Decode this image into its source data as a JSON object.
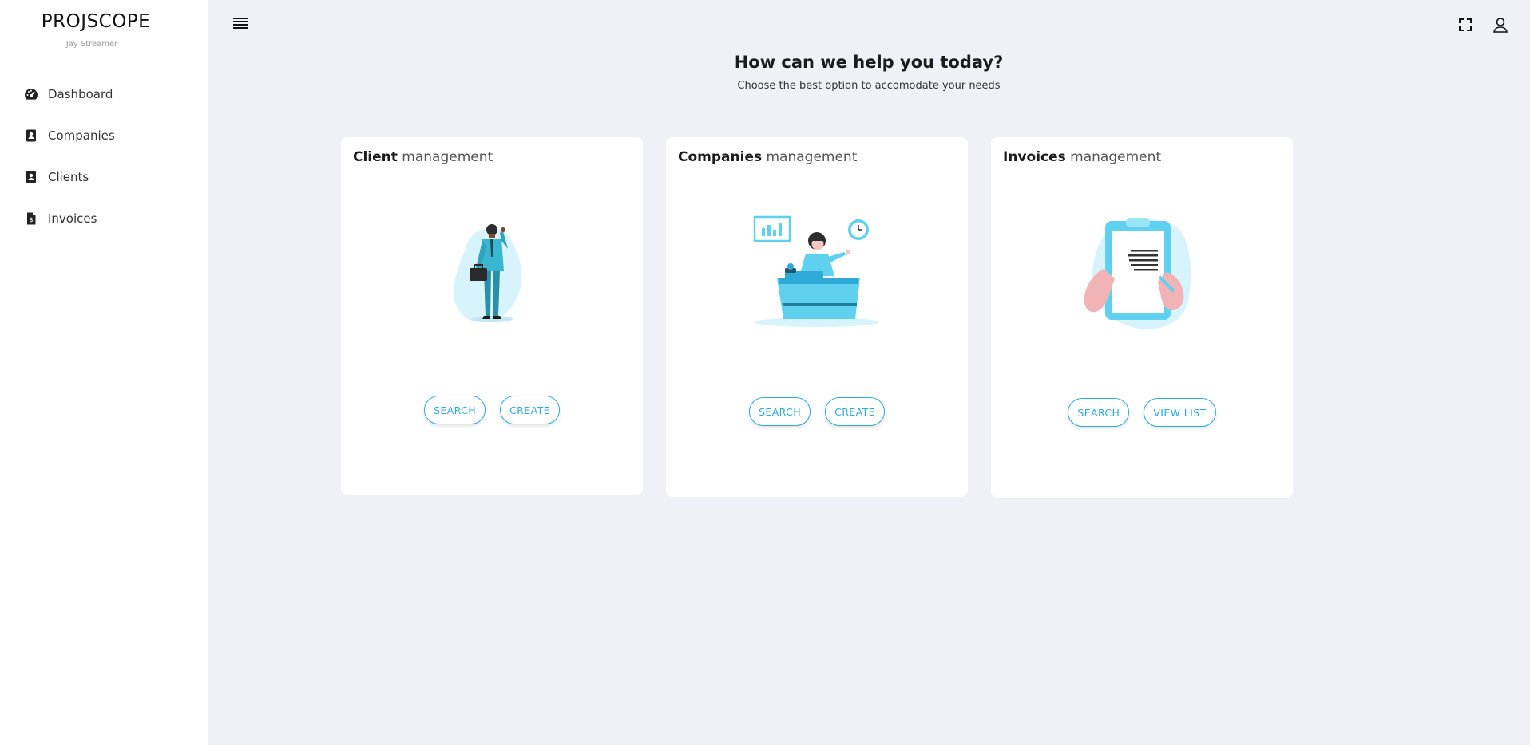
{
  "app": {
    "brand": "PROJSCOPE",
    "user_name": "Jay Streamer"
  },
  "sidebar": {
    "items": [
      {
        "label": "Dashboard",
        "icon": "dashboard-gauge-icon"
      },
      {
        "label": "Companies",
        "icon": "contact-book-icon"
      },
      {
        "label": "Clients",
        "icon": "contact-book-icon"
      },
      {
        "label": "Invoices",
        "icon": "invoice-file-icon"
      }
    ]
  },
  "topbar": {
    "menu_icon": "hamburger-menu-icon",
    "fullscreen_icon": "fullscreen-icon",
    "user_icon": "user-icon"
  },
  "hero": {
    "title": "How can we help you today?",
    "subtitle": "Choose the best option to accomodate your needs"
  },
  "cards": [
    {
      "title_bold": "Client",
      "title_rest": " management",
      "illustration": "businessman-on-phone-illustration",
      "buttons": [
        "SEARCH",
        "CREATE"
      ]
    },
    {
      "title_bold": "Companies",
      "title_rest": " management",
      "illustration": "receptionist-desk-illustration",
      "buttons": [
        "SEARCH",
        "CREATE"
      ]
    },
    {
      "title_bold": "Invoices",
      "title_rest": " management",
      "illustration": "clipboard-signing-illustration",
      "buttons": [
        "SEARCH",
        "VIEW LIST"
      ]
    }
  ],
  "colors": {
    "accent": "#2fa9d7",
    "illustration_blue": "#5fd0ee",
    "background": "#f0f1f6",
    "card": "#ffffff"
  }
}
